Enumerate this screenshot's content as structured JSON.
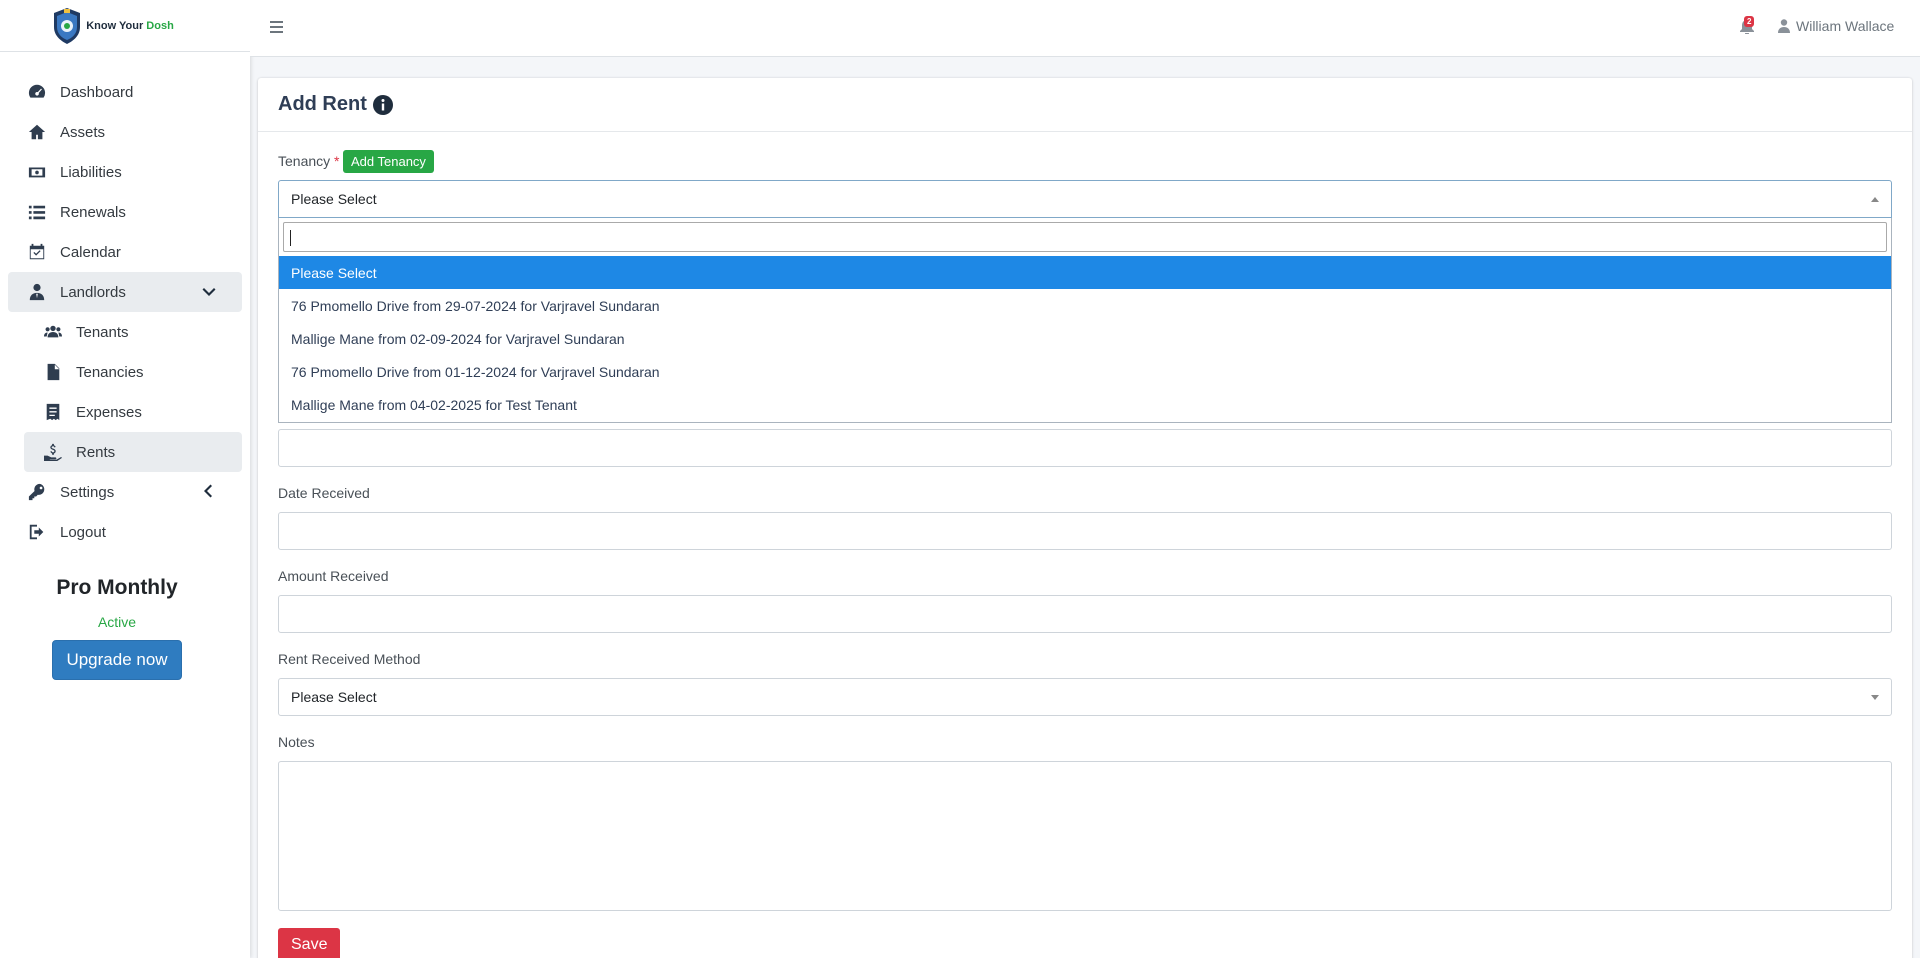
{
  "brand": {
    "name_prefix": "Know Your ",
    "name_accent": "Dosh"
  },
  "sidebar": {
    "items": [
      {
        "label": "Dashboard",
        "icon": "dashboard-icon"
      },
      {
        "label": "Assets",
        "icon": "home-icon"
      },
      {
        "label": "Liabilities",
        "icon": "money-icon"
      },
      {
        "label": "Renewals",
        "icon": "list-icon"
      },
      {
        "label": "Calendar",
        "icon": "calendar-icon"
      },
      {
        "label": "Landlords",
        "icon": "user-tie-icon"
      }
    ],
    "sub_items": [
      {
        "label": "Tenants",
        "icon": "users-icon"
      },
      {
        "label": "Tenancies",
        "icon": "contract-icon"
      },
      {
        "label": "Expenses",
        "icon": "receipt-icon"
      },
      {
        "label": "Rents",
        "icon": "hand-money-icon"
      }
    ],
    "bottom_items": [
      {
        "label": "Settings",
        "icon": "key-icon"
      },
      {
        "label": "Logout",
        "icon": "logout-icon"
      }
    ],
    "plan": {
      "title": "Pro Monthly",
      "status": "Active",
      "upgrade_label": "Upgrade now"
    }
  },
  "topbar": {
    "notification_count": "2",
    "user_name": "William Wallace"
  },
  "form": {
    "title": "Add Rent",
    "tenancy_label": "Tenancy",
    "required_mark": "*",
    "add_tenancy_label": "Add Tenancy",
    "tenancy_value": "Please Select",
    "dropdown_options": [
      "Please Select",
      "76 Pmomello Drive from 29-07-2024 for Varjravel Sundaran",
      "Mallige Mane from 02-09-2024 for Varjravel Sundaran",
      "76 Pmomello Drive from 01-12-2024 for Varjravel Sundaran",
      "Mallige Mane from 04-02-2025 for Test Tenant"
    ],
    "date_received_label": "Date Received",
    "amount_received_label": "Amount Received",
    "method_label": "Rent Received Method",
    "method_value": "Please Select",
    "notes_label": "Notes",
    "save_label": "Save"
  },
  "colors": {
    "accent": "#1e88e5",
    "success": "#28a745",
    "danger": "#dc3545",
    "primary": "#2f7cc0"
  }
}
